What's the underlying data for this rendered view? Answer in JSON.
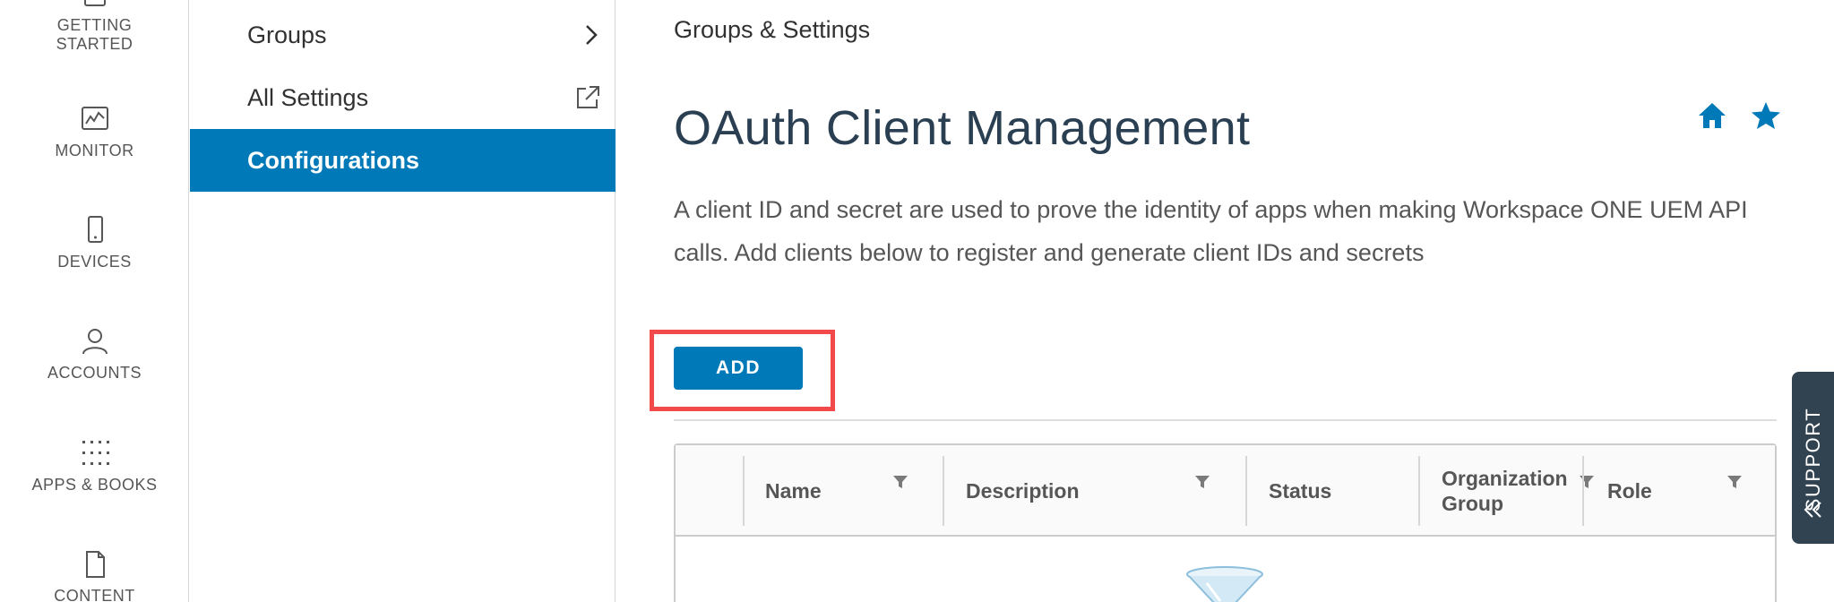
{
  "rail": {
    "items": [
      {
        "label": "GETTING STARTED",
        "icon": "getting-started-icon"
      },
      {
        "label": "MONITOR",
        "icon": "monitor-icon"
      },
      {
        "label": "DEVICES",
        "icon": "devices-icon"
      },
      {
        "label": "ACCOUNTS",
        "icon": "accounts-icon"
      },
      {
        "label": "APPS & BOOKS",
        "icon": "apps-books-icon"
      },
      {
        "label": "CONTENT",
        "icon": "content-icon"
      }
    ]
  },
  "subnav": {
    "items": [
      {
        "label": "Groups",
        "icon": "chevron-right-icon"
      },
      {
        "label": "All Settings",
        "icon": "external-link-icon"
      },
      {
        "label": "Configurations",
        "active": true
      }
    ]
  },
  "main": {
    "breadcrumb": "Groups & Settings",
    "title": "OAuth Client Management",
    "description": "A client ID and secret are used to prove the identity of apps when making Workspace ONE UEM API calls. Add clients below to register and generate client IDs and secrets",
    "add_label": "ADD",
    "title_icons": [
      "home-icon",
      "star-icon"
    ]
  },
  "grid": {
    "columns": [
      {
        "label": "Name",
        "filter": true
      },
      {
        "label": "Description",
        "filter": true
      },
      {
        "label": "Status",
        "filter": false
      },
      {
        "label": "Organization Group",
        "filter": true
      },
      {
        "label": "Role",
        "filter": true
      }
    ],
    "empty_icon": "empty-filter-icon"
  },
  "support": {
    "label": "SUPPORT",
    "icon": "double-chevron-left-icon"
  },
  "colors": {
    "accent": "#0079b8",
    "highlight": "#f24a4a",
    "support_bg": "#314351",
    "title": "#2a3f52"
  }
}
